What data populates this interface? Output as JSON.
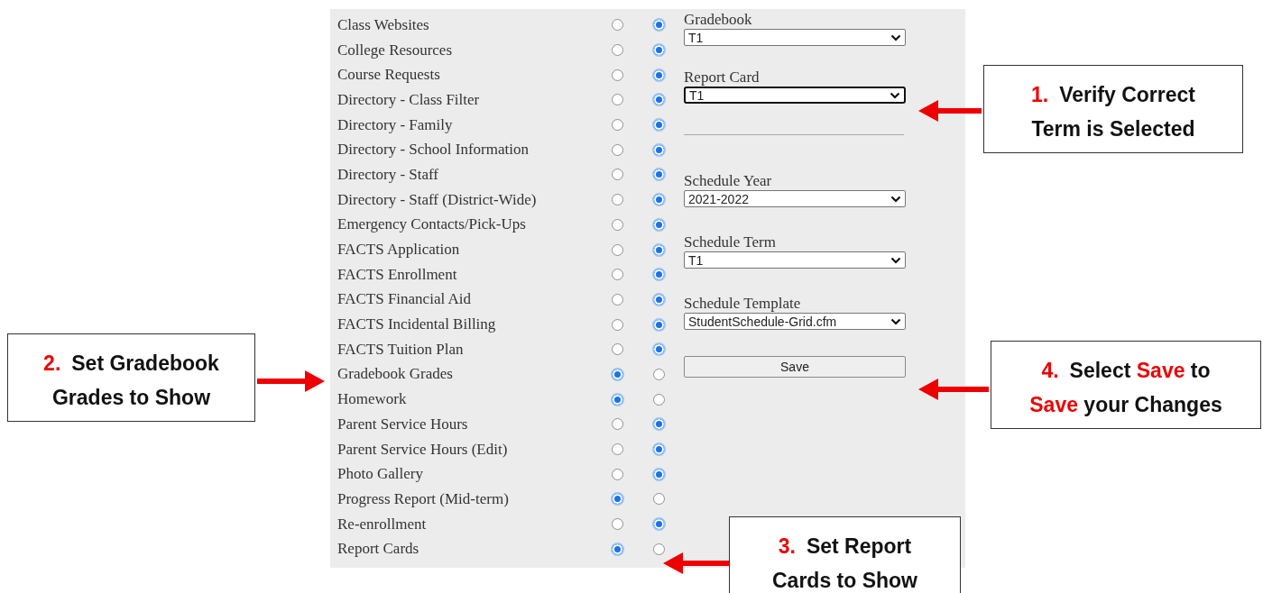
{
  "settings": [
    {
      "label": "Class Websites",
      "show": false
    },
    {
      "label": "College Resources",
      "show": false
    },
    {
      "label": "Course Requests",
      "show": false
    },
    {
      "label": "Directory - Class Filter",
      "show": false
    },
    {
      "label": "Directory - Family",
      "show": false
    },
    {
      "label": "Directory - School Information",
      "show": false
    },
    {
      "label": "Directory - Staff",
      "show": false
    },
    {
      "label": "Directory - Staff (District-Wide)",
      "show": false
    },
    {
      "label": "Emergency Contacts/Pick-Ups",
      "show": false
    },
    {
      "label": "FACTS Application",
      "show": false
    },
    {
      "label": "FACTS Enrollment",
      "show": false
    },
    {
      "label": "FACTS Financial Aid",
      "show": false
    },
    {
      "label": "FACTS Incidental Billing",
      "show": false
    },
    {
      "label": "FACTS Tuition Plan",
      "show": false
    },
    {
      "label": "Gradebook Grades",
      "show": true
    },
    {
      "label": "Homework",
      "show": true
    },
    {
      "label": "Parent Service Hours",
      "show": false
    },
    {
      "label": "Parent Service Hours (Edit)",
      "show": false
    },
    {
      "label": "Photo Gallery",
      "show": false
    },
    {
      "label": "Progress Report (Mid-term)",
      "show": true
    },
    {
      "label": "Re-enrollment",
      "show": false
    },
    {
      "label": "Report Cards",
      "show": true
    }
  ],
  "fields": [
    {
      "label": "Gradebook",
      "value": "T1",
      "focused": false
    },
    {
      "label": "Report Card",
      "value": "T1",
      "focused": true
    },
    {
      "label": "Schedule Year",
      "value": "2021-2022",
      "focused": false
    },
    {
      "label": "Schedule Term",
      "value": "T1",
      "focused": false
    },
    {
      "label": "Schedule Template",
      "value": "StudentSchedule-Grid.cfm",
      "focused": false
    }
  ],
  "save_button": "Save",
  "callouts": [
    {
      "number": "1.",
      "lines": [
        "Verify Correct",
        "Term is Selected"
      ]
    },
    {
      "number": "2.",
      "lines": [
        "Set Gradebook",
        "Grades to Show"
      ]
    },
    {
      "number": "3.",
      "lines": [
        "Set Report",
        "Cards to Show"
      ]
    },
    {
      "number": "4.",
      "lines": [
        "Select **Save** to",
        "**Save** your Changes"
      ]
    }
  ]
}
